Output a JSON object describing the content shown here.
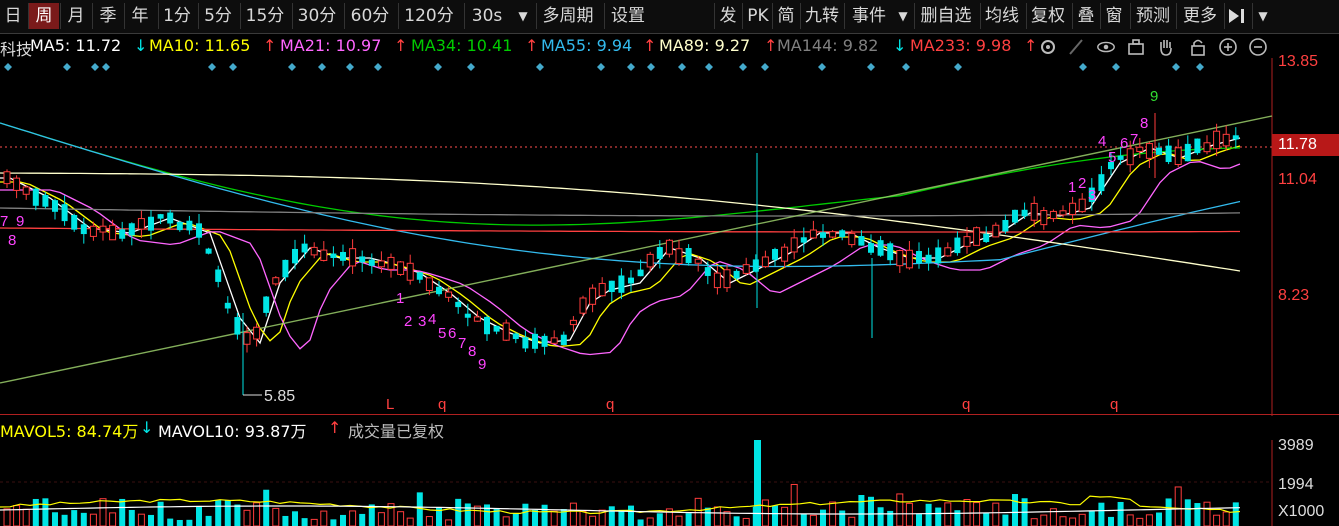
{
  "toolbar": {
    "day": "日",
    "week": "周",
    "month": "月",
    "season": "季",
    "year": "年",
    "m1": "1分",
    "m5": "5分",
    "m15": "15分",
    "m30": "30分",
    "m60": "60分",
    "m120": "120分",
    "s30": "30s",
    "multi_period": "多周期",
    "settings": "设置",
    "fa": "发",
    "pk": "PK",
    "jian": "简",
    "jiuzhuan": "九转",
    "event": "事件",
    "del_self": "删自选",
    "ma_line": "均线",
    "fuquan": "复权",
    "die": "叠",
    "chuang": "窗",
    "forecast": "预测",
    "more": "更多"
  },
  "ma": {
    "name": "科技",
    "ma5": "MA5: 11.72",
    "ma5_arrow": "↓",
    "ma10": "MA10: 11.65",
    "ma10_arrow": "↑",
    "ma21": "MA21: 10.97",
    "ma21_arrow": "↑",
    "ma34": "MA34: 10.41",
    "ma34_arrow": "↑",
    "ma55": "MA55: 9.94",
    "ma55_arrow": "↑",
    "ma89": "MA89: 9.27",
    "ma89_arrow": "↑",
    "ma144": "MA144: 9.82",
    "ma144_arrow": "↓",
    "ma233": "MA233: 9.98",
    "ma233_arrow": "↑"
  },
  "price_axis": {
    "p1": "13.85",
    "p2": "11.78",
    "p3": "11.04",
    "p4": "8.23"
  },
  "annotations": {
    "low_label": "5.85",
    "marker_L": "L",
    "marker_q1": "q",
    "marker_q2": "q",
    "marker_q3": "q",
    "marker_q4": "q",
    "left_7": "7",
    "left_8": "8",
    "left_9": "9",
    "seq1": [
      "1",
      "2",
      "3",
      "4",
      "5",
      "6",
      "7",
      "8",
      "9"
    ],
    "seq2": [
      "1",
      "2",
      "3",
      "4",
      "5",
      "6",
      "7",
      "8",
      "9"
    ]
  },
  "volume": {
    "mavol5": "MAVOL5: 84.74万",
    "mavol5_arrow": "↓",
    "mavol10": "MAVOL10: 93.87万",
    "mavol10_arrow": "↑",
    "note": "成交量已复权",
    "axis1": "3989",
    "axis2": "1994",
    "unit": "X1000"
  },
  "colors": {
    "up": "#ff3c3c",
    "down": "#00e5e5",
    "ma5": "#ffffff",
    "ma10": "#ffff00",
    "ma21": "#ff66ff",
    "ma34": "#00cc00",
    "ma55": "#33bbee",
    "ma89": "#ffffcc",
    "ma144": "#808080",
    "ma233": "#ff4040"
  }
}
